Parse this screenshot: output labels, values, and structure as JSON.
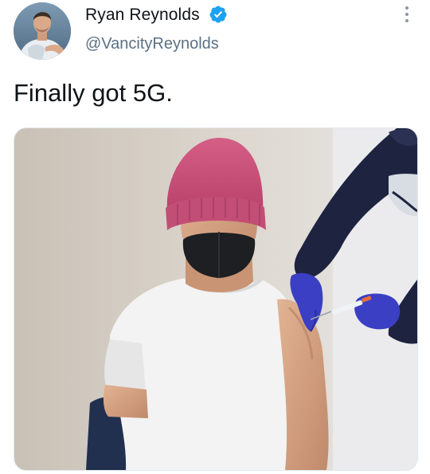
{
  "author": {
    "display_name": "Ryan Reynolds",
    "handle": "@VancityReynolds",
    "verified": true,
    "verified_icon": "verified-badge-icon"
  },
  "tweet": {
    "text": "Finally got 5G."
  },
  "menu": {
    "icon": "more-options-icon"
  },
  "colors": {
    "verified_blue": "#1da1f2",
    "handle_gray": "#5b7083",
    "text_dark": "#0f1419"
  }
}
